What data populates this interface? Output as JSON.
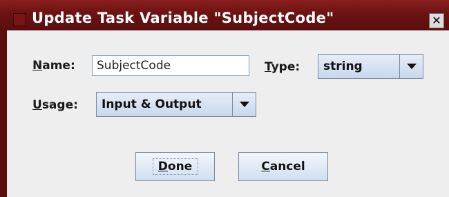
{
  "dialog": {
    "title": "Update Task Variable \"SubjectCode\"",
    "close_glyph": "✕"
  },
  "form": {
    "name_label_key": "N",
    "name_label_rest": "ame:",
    "name_value": "SubjectCode",
    "type_label_key": "T",
    "type_label_rest": "ype:",
    "type_value": "string",
    "usage_label_key": "U",
    "usage_label_rest": "sage:",
    "usage_value": "Input & Output"
  },
  "buttons": {
    "done_key": "D",
    "done_rest": "one",
    "cancel_key": "C",
    "cancel_rest": "ancel"
  },
  "icons": {
    "title_icon": "window-menu-icon",
    "close_icon": "close-icon",
    "dropdown_icon": "chevron-down-icon"
  },
  "colors": {
    "titlebar": "#6b1212",
    "dialog_bg": "#eeeeee",
    "button_gradient_top": "#f2f6fb",
    "button_gradient_bottom": "#d0dff0"
  }
}
